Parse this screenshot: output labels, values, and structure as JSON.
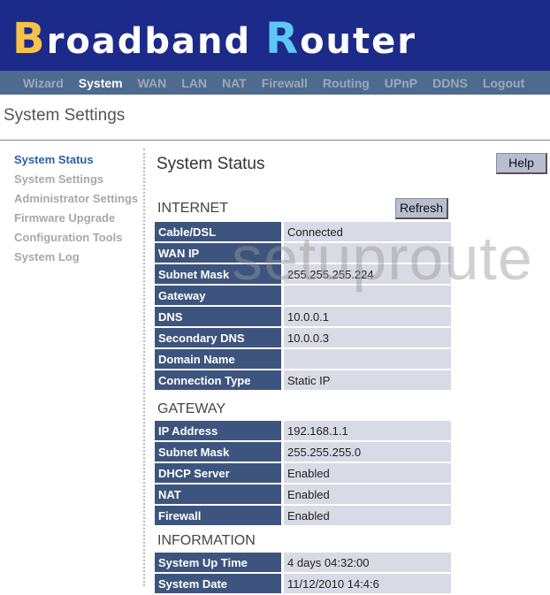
{
  "header": {
    "logo_first": "B",
    "logo_mid": "roadband ",
    "logo_r": "R",
    "logo_end": "outer"
  },
  "nav": [
    "Wizard",
    "System",
    "WAN",
    "LAN",
    "NAT",
    "Firewall",
    "Routing",
    "UPnP",
    "DDNS",
    "Logout"
  ],
  "nav_active": "System",
  "page_title": "System Settings",
  "sidebar": [
    "System Status",
    "System Settings",
    "Administrator Settings",
    "Firmware Upgrade",
    "Configuration Tools",
    "System Log"
  ],
  "content": {
    "title": "System Status",
    "help_label": "Help",
    "refresh_label": "Refresh",
    "internet": {
      "heading": "INTERNET",
      "rows": [
        {
          "k": "Cable/DSL",
          "v": "Connected"
        },
        {
          "k": "WAN IP",
          "v": ""
        },
        {
          "k": "Subnet Mask",
          "v": "255.255.255.224"
        },
        {
          "k": "Gateway",
          "v": ""
        },
        {
          "k": "DNS",
          "v": "10.0.0.1"
        },
        {
          "k": "Secondary DNS",
          "v": "10.0.0.3"
        },
        {
          "k": "Domain Name",
          "v": ""
        },
        {
          "k": "Connection Type",
          "v": "Static IP"
        }
      ]
    },
    "gateway": {
      "heading": "GATEWAY",
      "rows": [
        {
          "k": "IP Address",
          "v": "192.168.1.1"
        },
        {
          "k": "Subnet Mask",
          "v": "255.255.255.0"
        },
        {
          "k": "DHCP Server",
          "v": "Enabled"
        },
        {
          "k": "NAT",
          "v": "Enabled"
        },
        {
          "k": "Firewall",
          "v": "Enabled"
        }
      ]
    },
    "information": {
      "heading": "INFORMATION",
      "rows": [
        {
          "k": "System Up Time",
          "v": "4 days 04:32:00"
        },
        {
          "k": "System Date",
          "v": "11/12/2010 14:4:6"
        }
      ]
    }
  },
  "watermark": "setuproute"
}
